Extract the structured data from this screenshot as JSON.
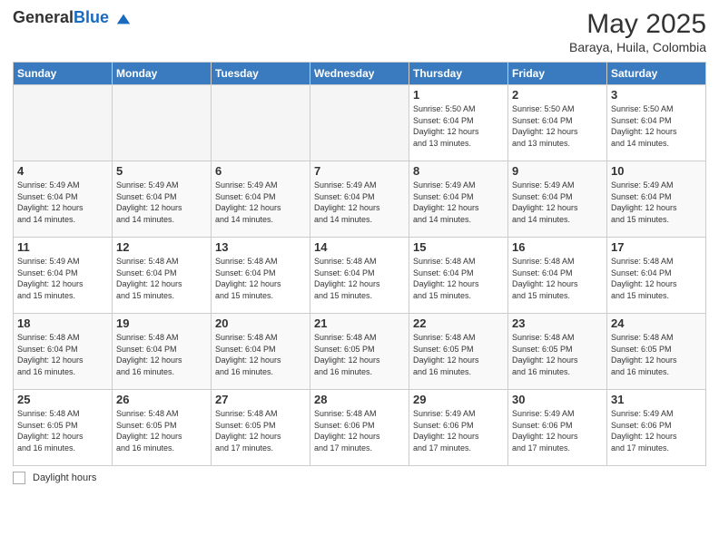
{
  "header": {
    "logo_general": "General",
    "logo_blue": "Blue",
    "title": "May 2025",
    "subtitle": "Baraya, Huila, Colombia"
  },
  "weekdays": [
    "Sunday",
    "Monday",
    "Tuesday",
    "Wednesday",
    "Thursday",
    "Friday",
    "Saturday"
  ],
  "weeks": [
    [
      {
        "day": "",
        "info": ""
      },
      {
        "day": "",
        "info": ""
      },
      {
        "day": "",
        "info": ""
      },
      {
        "day": "",
        "info": ""
      },
      {
        "day": "1",
        "info": "Sunrise: 5:50 AM\nSunset: 6:04 PM\nDaylight: 12 hours\nand 13 minutes."
      },
      {
        "day": "2",
        "info": "Sunrise: 5:50 AM\nSunset: 6:04 PM\nDaylight: 12 hours\nand 13 minutes."
      },
      {
        "day": "3",
        "info": "Sunrise: 5:50 AM\nSunset: 6:04 PM\nDaylight: 12 hours\nand 14 minutes."
      }
    ],
    [
      {
        "day": "4",
        "info": "Sunrise: 5:49 AM\nSunset: 6:04 PM\nDaylight: 12 hours\nand 14 minutes."
      },
      {
        "day": "5",
        "info": "Sunrise: 5:49 AM\nSunset: 6:04 PM\nDaylight: 12 hours\nand 14 minutes."
      },
      {
        "day": "6",
        "info": "Sunrise: 5:49 AM\nSunset: 6:04 PM\nDaylight: 12 hours\nand 14 minutes."
      },
      {
        "day": "7",
        "info": "Sunrise: 5:49 AM\nSunset: 6:04 PM\nDaylight: 12 hours\nand 14 minutes."
      },
      {
        "day": "8",
        "info": "Sunrise: 5:49 AM\nSunset: 6:04 PM\nDaylight: 12 hours\nand 14 minutes."
      },
      {
        "day": "9",
        "info": "Sunrise: 5:49 AM\nSunset: 6:04 PM\nDaylight: 12 hours\nand 14 minutes."
      },
      {
        "day": "10",
        "info": "Sunrise: 5:49 AM\nSunset: 6:04 PM\nDaylight: 12 hours\nand 15 minutes."
      }
    ],
    [
      {
        "day": "11",
        "info": "Sunrise: 5:49 AM\nSunset: 6:04 PM\nDaylight: 12 hours\nand 15 minutes."
      },
      {
        "day": "12",
        "info": "Sunrise: 5:48 AM\nSunset: 6:04 PM\nDaylight: 12 hours\nand 15 minutes."
      },
      {
        "day": "13",
        "info": "Sunrise: 5:48 AM\nSunset: 6:04 PM\nDaylight: 12 hours\nand 15 minutes."
      },
      {
        "day": "14",
        "info": "Sunrise: 5:48 AM\nSunset: 6:04 PM\nDaylight: 12 hours\nand 15 minutes."
      },
      {
        "day": "15",
        "info": "Sunrise: 5:48 AM\nSunset: 6:04 PM\nDaylight: 12 hours\nand 15 minutes."
      },
      {
        "day": "16",
        "info": "Sunrise: 5:48 AM\nSunset: 6:04 PM\nDaylight: 12 hours\nand 15 minutes."
      },
      {
        "day": "17",
        "info": "Sunrise: 5:48 AM\nSunset: 6:04 PM\nDaylight: 12 hours\nand 15 minutes."
      }
    ],
    [
      {
        "day": "18",
        "info": "Sunrise: 5:48 AM\nSunset: 6:04 PM\nDaylight: 12 hours\nand 16 minutes."
      },
      {
        "day": "19",
        "info": "Sunrise: 5:48 AM\nSunset: 6:04 PM\nDaylight: 12 hours\nand 16 minutes."
      },
      {
        "day": "20",
        "info": "Sunrise: 5:48 AM\nSunset: 6:04 PM\nDaylight: 12 hours\nand 16 minutes."
      },
      {
        "day": "21",
        "info": "Sunrise: 5:48 AM\nSunset: 6:05 PM\nDaylight: 12 hours\nand 16 minutes."
      },
      {
        "day": "22",
        "info": "Sunrise: 5:48 AM\nSunset: 6:05 PM\nDaylight: 12 hours\nand 16 minutes."
      },
      {
        "day": "23",
        "info": "Sunrise: 5:48 AM\nSunset: 6:05 PM\nDaylight: 12 hours\nand 16 minutes."
      },
      {
        "day": "24",
        "info": "Sunrise: 5:48 AM\nSunset: 6:05 PM\nDaylight: 12 hours\nand 16 minutes."
      }
    ],
    [
      {
        "day": "25",
        "info": "Sunrise: 5:48 AM\nSunset: 6:05 PM\nDaylight: 12 hours\nand 16 minutes."
      },
      {
        "day": "26",
        "info": "Sunrise: 5:48 AM\nSunset: 6:05 PM\nDaylight: 12 hours\nand 16 minutes."
      },
      {
        "day": "27",
        "info": "Sunrise: 5:48 AM\nSunset: 6:05 PM\nDaylight: 12 hours\nand 17 minutes."
      },
      {
        "day": "28",
        "info": "Sunrise: 5:48 AM\nSunset: 6:06 PM\nDaylight: 12 hours\nand 17 minutes."
      },
      {
        "day": "29",
        "info": "Sunrise: 5:49 AM\nSunset: 6:06 PM\nDaylight: 12 hours\nand 17 minutes."
      },
      {
        "day": "30",
        "info": "Sunrise: 5:49 AM\nSunset: 6:06 PM\nDaylight: 12 hours\nand 17 minutes."
      },
      {
        "day": "31",
        "info": "Sunrise: 5:49 AM\nSunset: 6:06 PM\nDaylight: 12 hours\nand 17 minutes."
      }
    ]
  ],
  "footer": {
    "legend_label": "Daylight hours"
  }
}
